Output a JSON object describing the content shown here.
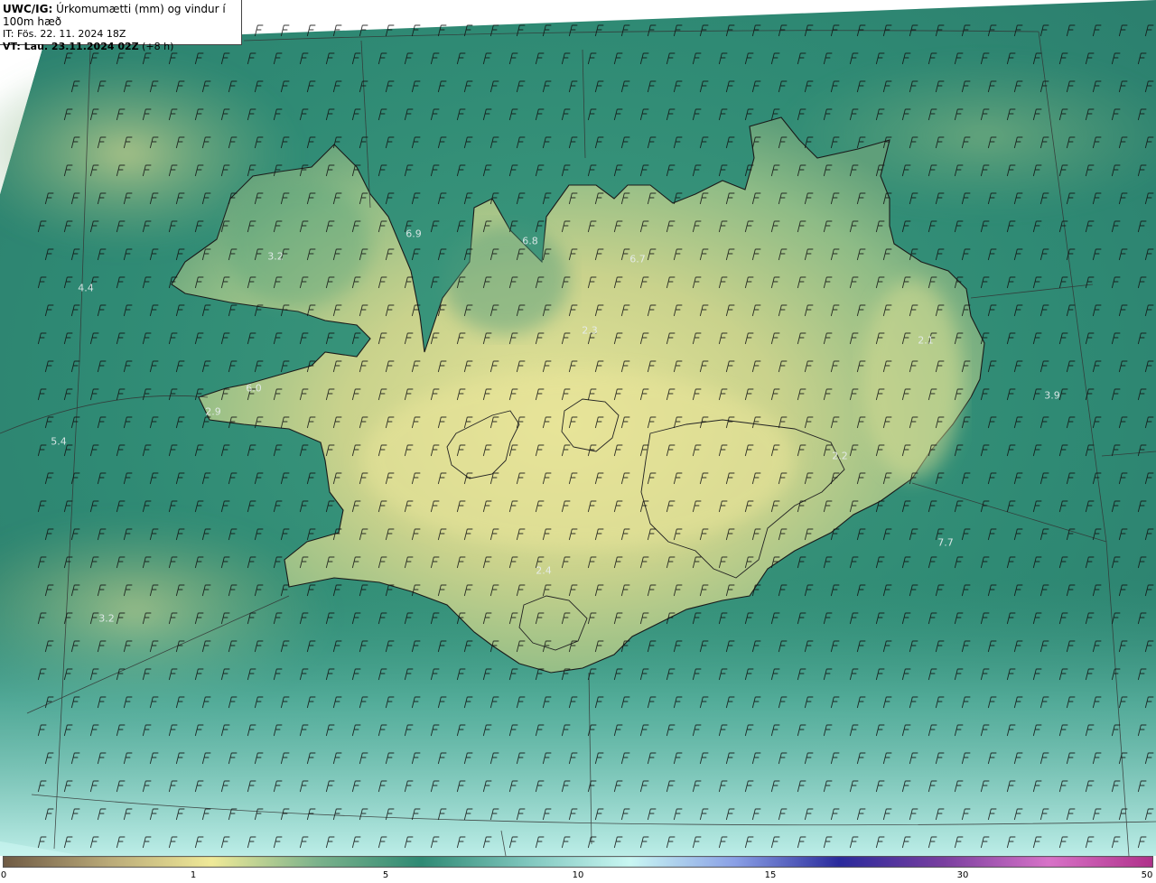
{
  "header": {
    "product": "UWC/IG:",
    "title": " Úrkomumætti (mm) og vindur í 100m hæð",
    "it_line": "IT: Fös. 22. 11. 2024 18Z",
    "vt_label": "VT: Lau. 23.11.2024 02Z",
    "vt_suffix": " (+8 h)"
  },
  "colors": {
    "land_low": "#dfe08c",
    "land_mid": "#6fa77c",
    "sea": "#2f8a74",
    "sea_light": "#a9e2de",
    "coast": "#1a1a1a"
  },
  "point_labels": [
    {
      "text": "6.9"
    },
    {
      "text": "6.8"
    },
    {
      "text": "6.7"
    },
    {
      "text": "3.2"
    },
    {
      "text": "4.4"
    },
    {
      "text": "2.3"
    },
    {
      "text": "2.1"
    },
    {
      "text": "6.0"
    },
    {
      "text": "3.9"
    },
    {
      "text": "2.9"
    },
    {
      "text": "5.4"
    },
    {
      "text": "7.7"
    },
    {
      "text": "2.4"
    },
    {
      "text": "3.2"
    },
    {
      "text": "2.2"
    }
  ],
  "colorbar": {
    "ticks": [
      "0",
      "1",
      "5",
      "10",
      "15",
      "30",
      "50"
    ],
    "stops": [
      "#6f5a44",
      "#b9a978",
      "#f0ea98",
      "#7db38c",
      "#2f8a74",
      "#7fc6bd",
      "#c9f7f3",
      "#8aa0e6",
      "#2a2a9c",
      "#7a3fa0",
      "#d873c8",
      "#b0308a"
    ]
  }
}
